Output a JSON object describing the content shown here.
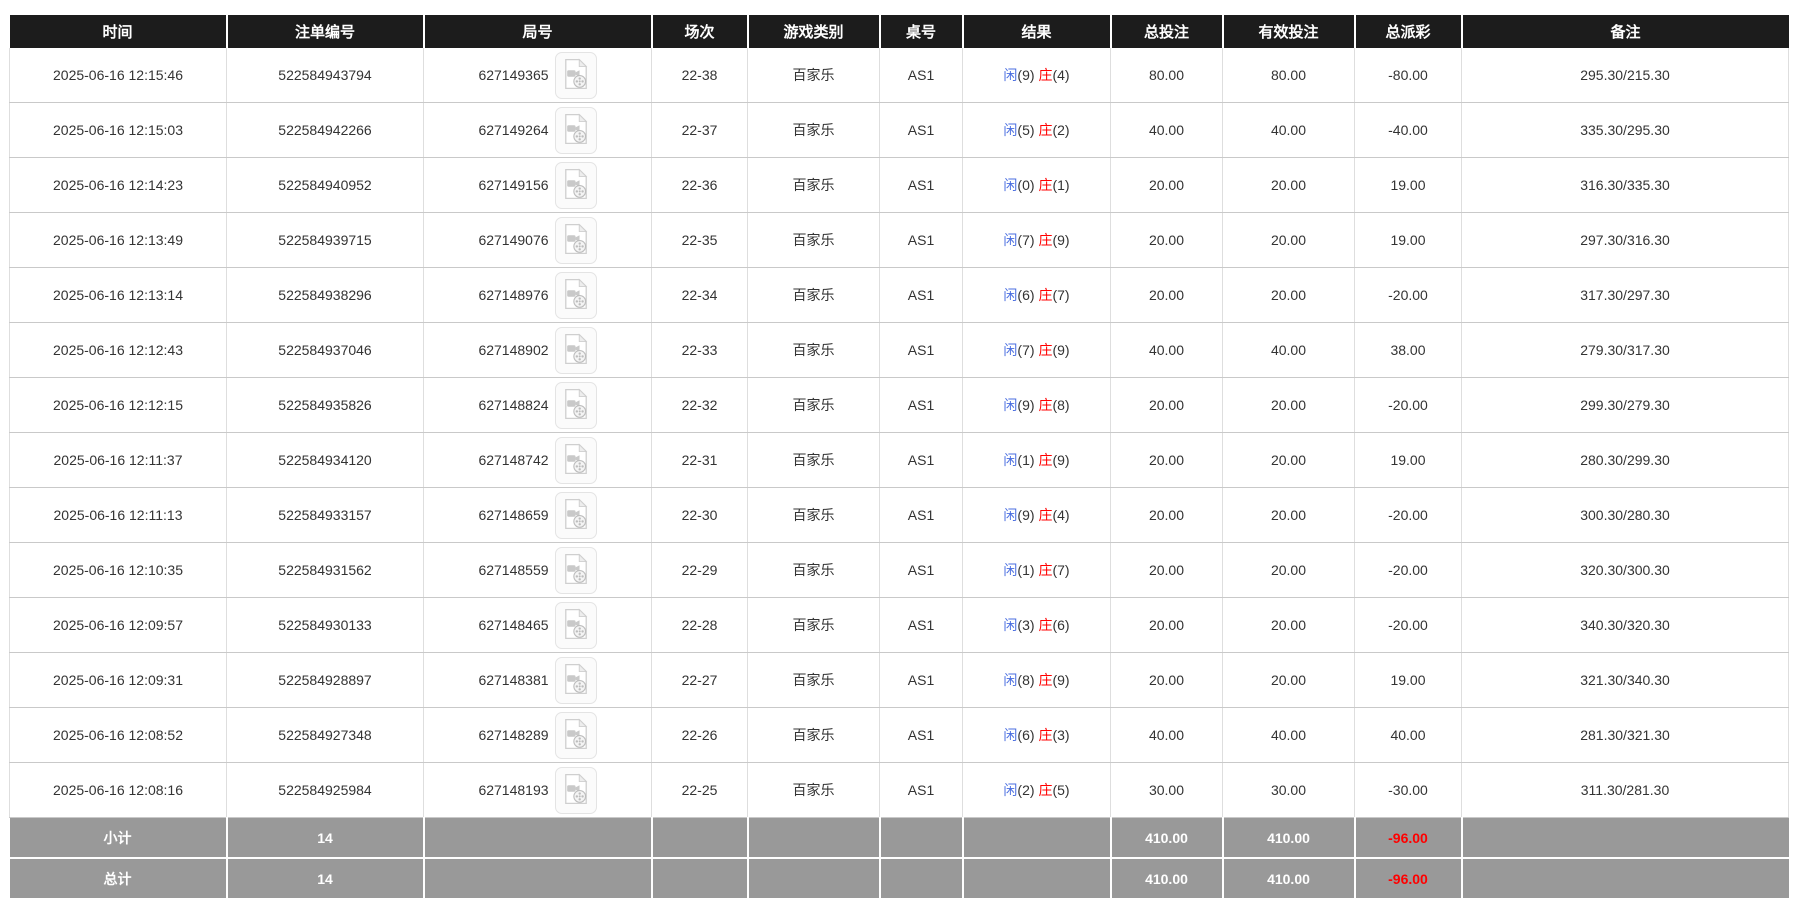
{
  "table": {
    "columns": [
      {
        "key": "time",
        "label": "时间"
      },
      {
        "key": "bet_id",
        "label": "注单编号"
      },
      {
        "key": "round_id",
        "label": "局号"
      },
      {
        "key": "session",
        "label": "场次"
      },
      {
        "key": "game_type",
        "label": "游戏类别"
      },
      {
        "key": "table_no",
        "label": "桌号"
      },
      {
        "key": "result",
        "label": "结果"
      },
      {
        "key": "total_bet",
        "label": "总投注"
      },
      {
        "key": "valid_bet",
        "label": "有效投注"
      },
      {
        "key": "total_payout",
        "label": "总派彩"
      },
      {
        "key": "remark",
        "label": "备注"
      }
    ],
    "result_labels": {
      "player": "闲",
      "banker": "庄"
    },
    "rows": [
      {
        "time": "2025-06-16 12:15:46",
        "bet_id": "522584943794",
        "round_id": "627149365",
        "session": "22-38",
        "game_type": "百家乐",
        "table_no": "AS1",
        "player_score": "9",
        "banker_score": "4",
        "total_bet": "80.00",
        "valid_bet": "80.00",
        "total_payout": "-80.00",
        "remark": "295.30/215.30"
      },
      {
        "time": "2025-06-16 12:15:03",
        "bet_id": "522584942266",
        "round_id": "627149264",
        "session": "22-37",
        "game_type": "百家乐",
        "table_no": "AS1",
        "player_score": "5",
        "banker_score": "2",
        "total_bet": "40.00",
        "valid_bet": "40.00",
        "total_payout": "-40.00",
        "remark": "335.30/295.30"
      },
      {
        "time": "2025-06-16 12:14:23",
        "bet_id": "522584940952",
        "round_id": "627149156",
        "session": "22-36",
        "game_type": "百家乐",
        "table_no": "AS1",
        "player_score": "0",
        "banker_score": "1",
        "total_bet": "20.00",
        "valid_bet": "20.00",
        "total_payout": "19.00",
        "remark": "316.30/335.30"
      },
      {
        "time": "2025-06-16 12:13:49",
        "bet_id": "522584939715",
        "round_id": "627149076",
        "session": "22-35",
        "game_type": "百家乐",
        "table_no": "AS1",
        "player_score": "7",
        "banker_score": "9",
        "total_bet": "20.00",
        "valid_bet": "20.00",
        "total_payout": "19.00",
        "remark": "297.30/316.30"
      },
      {
        "time": "2025-06-16 12:13:14",
        "bet_id": "522584938296",
        "round_id": "627148976",
        "session": "22-34",
        "game_type": "百家乐",
        "table_no": "AS1",
        "player_score": "6",
        "banker_score": "7",
        "total_bet": "20.00",
        "valid_bet": "20.00",
        "total_payout": "-20.00",
        "remark": "317.30/297.30"
      },
      {
        "time": "2025-06-16 12:12:43",
        "bet_id": "522584937046",
        "round_id": "627148902",
        "session": "22-33",
        "game_type": "百家乐",
        "table_no": "AS1",
        "player_score": "7",
        "banker_score": "9",
        "total_bet": "40.00",
        "valid_bet": "40.00",
        "total_payout": "38.00",
        "remark": "279.30/317.30"
      },
      {
        "time": "2025-06-16 12:12:15",
        "bet_id": "522584935826",
        "round_id": "627148824",
        "session": "22-32",
        "game_type": "百家乐",
        "table_no": "AS1",
        "player_score": "9",
        "banker_score": "8",
        "total_bet": "20.00",
        "valid_bet": "20.00",
        "total_payout": "-20.00",
        "remark": "299.30/279.30"
      },
      {
        "time": "2025-06-16 12:11:37",
        "bet_id": "522584934120",
        "round_id": "627148742",
        "session": "22-31",
        "game_type": "百家乐",
        "table_no": "AS1",
        "player_score": "1",
        "banker_score": "9",
        "total_bet": "20.00",
        "valid_bet": "20.00",
        "total_payout": "19.00",
        "remark": "280.30/299.30"
      },
      {
        "time": "2025-06-16 12:11:13",
        "bet_id": "522584933157",
        "round_id": "627148659",
        "session": "22-30",
        "game_type": "百家乐",
        "table_no": "AS1",
        "player_score": "9",
        "banker_score": "4",
        "total_bet": "20.00",
        "valid_bet": "20.00",
        "total_payout": "-20.00",
        "remark": "300.30/280.30"
      },
      {
        "time": "2025-06-16 12:10:35",
        "bet_id": "522584931562",
        "round_id": "627148559",
        "session": "22-29",
        "game_type": "百家乐",
        "table_no": "AS1",
        "player_score": "1",
        "banker_score": "7",
        "total_bet": "20.00",
        "valid_bet": "20.00",
        "total_payout": "-20.00",
        "remark": "320.30/300.30"
      },
      {
        "time": "2025-06-16 12:09:57",
        "bet_id": "522584930133",
        "round_id": "627148465",
        "session": "22-28",
        "game_type": "百家乐",
        "table_no": "AS1",
        "player_score": "3",
        "banker_score": "6",
        "total_bet": "20.00",
        "valid_bet": "20.00",
        "total_payout": "-20.00",
        "remark": "340.30/320.30"
      },
      {
        "time": "2025-06-16 12:09:31",
        "bet_id": "522584928897",
        "round_id": "627148381",
        "session": "22-27",
        "game_type": "百家乐",
        "table_no": "AS1",
        "player_score": "8",
        "banker_score": "9",
        "total_bet": "20.00",
        "valid_bet": "20.00",
        "total_payout": "19.00",
        "remark": "321.30/340.30"
      },
      {
        "time": "2025-06-16 12:08:52",
        "bet_id": "522584927348",
        "round_id": "627148289",
        "session": "22-26",
        "game_type": "百家乐",
        "table_no": "AS1",
        "player_score": "6",
        "banker_score": "3",
        "total_bet": "40.00",
        "valid_bet": "40.00",
        "total_payout": "40.00",
        "remark": "281.30/321.30"
      },
      {
        "time": "2025-06-16 12:08:16",
        "bet_id": "522584925984",
        "round_id": "627148193",
        "session": "22-25",
        "game_type": "百家乐",
        "table_no": "AS1",
        "player_score": "2",
        "banker_score": "5",
        "total_bet": "30.00",
        "valid_bet": "30.00",
        "total_payout": "-30.00",
        "remark": "311.30/281.30"
      }
    ],
    "footer_rows": [
      {
        "label": "小计",
        "count": "14",
        "total_bet": "410.00",
        "valid_bet": "410.00",
        "total_payout": "-96.00"
      },
      {
        "label": "总计",
        "count": "14",
        "total_bet": "410.00",
        "valid_bet": "410.00",
        "total_payout": "-96.00"
      }
    ]
  },
  "icons": {
    "round_video": "video-file-icon"
  },
  "colors": {
    "header_bg": "#1c1c1c",
    "footer_bg": "#999999",
    "bet_amount_blue": "#2b6ce0",
    "player_blue": "#4a6ee0",
    "banker_red": "#ff0000",
    "negative_red": "#ff0000",
    "body_text": "#333333"
  }
}
